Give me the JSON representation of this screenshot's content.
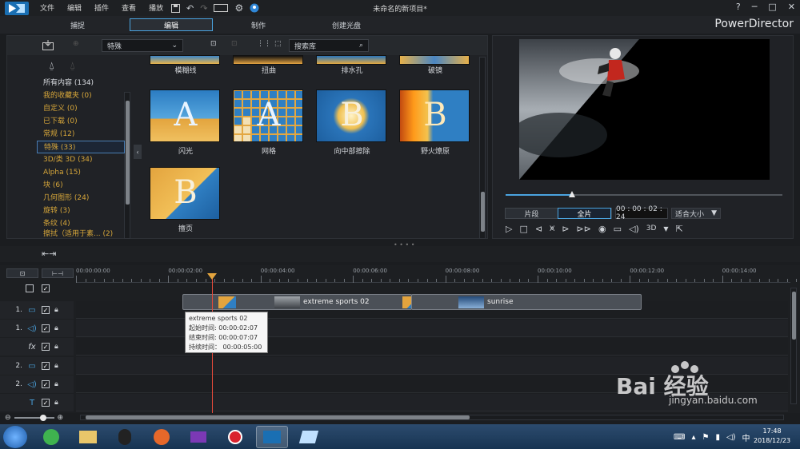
{
  "menu": {
    "items": [
      "文件",
      "编辑",
      "插件",
      "查看",
      "播放"
    ],
    "title": "未命名的新项目*",
    "help": "?"
  },
  "tabs": [
    {
      "label": "捕捉"
    },
    {
      "label": "编辑"
    },
    {
      "label": "制作"
    },
    {
      "label": "创建光盘"
    }
  ],
  "brand": "PowerDirector",
  "library": {
    "filter": "特殊",
    "search_placeholder": "搜索库",
    "categories": [
      {
        "label": "所有内容 (134)"
      },
      {
        "label": "我的收藏夹  (0)"
      },
      {
        "label": "自定义  (0)"
      },
      {
        "label": "已下载  (0)"
      },
      {
        "label": "常规  (12)"
      },
      {
        "label": "特殊  (33)"
      },
      {
        "label": "3D/类 3D  (34)"
      },
      {
        "label": "Alpha  (15)"
      },
      {
        "label": "块  (6)"
      },
      {
        "label": "几何图形  (24)"
      },
      {
        "label": "旋转  (3)"
      },
      {
        "label": "条纹  (4)"
      },
      {
        "label": "擦拭（适用于素...  (2)"
      }
    ],
    "thumbnails": [
      {
        "label": "模糊线"
      },
      {
        "label": "扭曲"
      },
      {
        "label": "排水孔"
      },
      {
        "label": "破镜"
      },
      {
        "label": "闪光"
      },
      {
        "label": "网格"
      },
      {
        "label": "向中部擦除"
      },
      {
        "label": "野火燎原"
      },
      {
        "label": "擅页"
      }
    ]
  },
  "preview": {
    "seg_clip": "片段",
    "seg_movie": "全片",
    "timecode": "00 : 00 : 02 : 24",
    "fit": "适合大小",
    "mode3d": "3D",
    "progress": 0.24
  },
  "timeline": {
    "ruler": [
      "00:00:00:00",
      "00:00:02:00",
      "00:00:04:00",
      "00:00:06:00",
      "00:00:08:00",
      "00:00:10:00",
      "00:00:12:00",
      "00:00:14:00"
    ],
    "tracks": [
      {
        "num": "1."
      },
      {
        "num": "1."
      },
      {
        "num": ""
      },
      {
        "num": "2."
      },
      {
        "num": "2."
      },
      {
        "num": ""
      }
    ],
    "clips": [
      {
        "label": "extreme sports 02"
      },
      {
        "label": "sunrise"
      }
    ],
    "tooltip": {
      "title": "extreme sports 02",
      "start": "起始时间: 00:00:02:07",
      "end": "结束时间: 00:00:07:07",
      "duration": "持续时间：  00:00:05:00"
    }
  },
  "taskbar": {
    "time": "17:48",
    "date": "2018/12/23"
  },
  "watermark": {
    "text": "Bai 经验",
    "url": "jingyan.baidu.com"
  },
  "colors": {
    "accent": "#4aa3df",
    "category": "#d6a63a",
    "playhead": "#e64a3a"
  }
}
